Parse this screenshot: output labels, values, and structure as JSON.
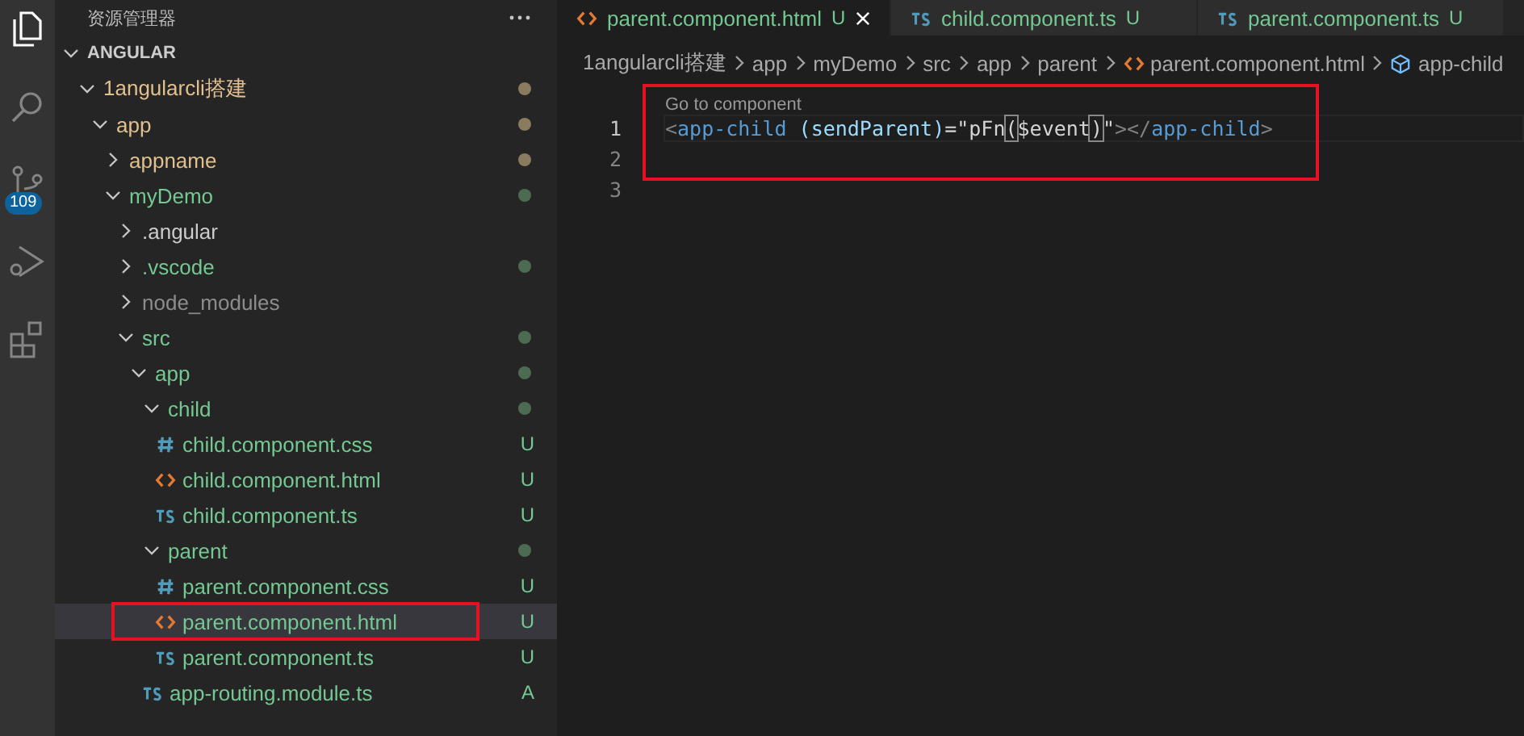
{
  "activity_bar": {
    "scm_badge": "109"
  },
  "explorer": {
    "title": "资源管理器",
    "root": {
      "name": "ANGULAR",
      "expanded": true,
      "children": [
        {
          "name": "1angularcli搭建",
          "kind": "folder",
          "expanded": true,
          "modified": true,
          "ignored": false,
          "color": "#8a7a5e",
          "children": [
            {
              "name": "app",
              "kind": "folder",
              "expanded": true,
              "modified": true,
              "ignored": false,
              "color": "#8a7a5e",
              "children": [
                {
                  "name": "appname",
                  "kind": "folder",
                  "expanded": false,
                  "modified": true,
                  "ignored": false,
                  "color": "#8a7a5e"
                },
                {
                  "name": "myDemo",
                  "kind": "folder",
                  "expanded": true,
                  "modified": false,
                  "ignored": false,
                  "color": "#4d6b52",
                  "children": [
                    {
                      "name": ".angular",
                      "kind": "folder",
                      "expanded": false,
                      "modified": false,
                      "ignored": false
                    },
                    {
                      "name": ".vscode",
                      "kind": "folder",
                      "expanded": false,
                      "modified": false,
                      "ignored": false,
                      "color": "#4d6b52"
                    },
                    {
                      "name": "node_modules",
                      "kind": "folder",
                      "expanded": false,
                      "modified": false,
                      "ignored": true
                    },
                    {
                      "name": "src",
                      "kind": "folder",
                      "expanded": true,
                      "modified": false,
                      "ignored": false,
                      "color": "#4d6b52",
                      "children": [
                        {
                          "name": "app",
                          "kind": "folder",
                          "expanded": true,
                          "modified": false,
                          "ignored": false,
                          "color": "#4d6b52",
                          "children": [
                            {
                              "name": "child",
                              "kind": "folder",
                              "expanded": true,
                              "modified": false,
                              "ignored": false,
                              "color": "#4d6b52",
                              "children": [
                                {
                                  "name": "child.component.css",
                                  "kind": "css",
                                  "modified": false,
                                  "ignored": false,
                                  "badge": "U",
                                  "selected": false
                                },
                                {
                                  "name": "child.component.html",
                                  "kind": "html",
                                  "modified": false,
                                  "ignored": false,
                                  "badge": "U",
                                  "selected": false
                                },
                                {
                                  "name": "child.component.ts",
                                  "kind": "ts",
                                  "modified": false,
                                  "ignored": false,
                                  "badge": "U",
                                  "selected": false
                                }
                              ]
                            },
                            {
                              "name": "parent",
                              "kind": "folder",
                              "expanded": true,
                              "modified": false,
                              "ignored": false,
                              "color": "#4d6b52",
                              "children": [
                                {
                                  "name": "parent.component.css",
                                  "kind": "css",
                                  "modified": false,
                                  "ignored": false,
                                  "badge": "U",
                                  "selected": false
                                },
                                {
                                  "name": "parent.component.html",
                                  "kind": "html",
                                  "modified": false,
                                  "ignored": false,
                                  "badge": "U",
                                  "selected": true,
                                  "annotated": true
                                },
                                {
                                  "name": "parent.component.ts",
                                  "kind": "ts",
                                  "modified": false,
                                  "ignored": false,
                                  "badge": "U",
                                  "selected": false
                                }
                              ]
                            },
                            {
                              "name": "app-routing.module.ts",
                              "kind": "ts",
                              "modified": false,
                              "ignored": false,
                              "badge": "A",
                              "selected": false
                            }
                          ]
                        }
                      ]
                    }
                  ]
                }
              ]
            }
          ]
        }
      ]
    }
  },
  "tabs": [
    {
      "label": "parent.component.html",
      "kind": "html",
      "badge": "U",
      "selected": true
    },
    {
      "label": "child.component.ts",
      "kind": "ts",
      "badge": "U",
      "selected": false
    },
    {
      "label": "parent.component.ts",
      "kind": "ts",
      "badge": "U",
      "selected": false
    }
  ],
  "breadcrumbs": [
    {
      "text": "1angularcli搭建",
      "kind": "folder"
    },
    {
      "text": "app",
      "kind": "folder"
    },
    {
      "text": "myDemo",
      "kind": "folder"
    },
    {
      "text": "src",
      "kind": "folder"
    },
    {
      "text": "app",
      "kind": "folder"
    },
    {
      "text": "parent",
      "kind": "folder"
    },
    {
      "text": "parent.component.html",
      "kind": "html"
    },
    {
      "text": "app-child",
      "kind": "element"
    }
  ],
  "editor": {
    "annotated": true,
    "code_lens": "Go to component",
    "lines": [
      {
        "number": "1",
        "current": true,
        "tokens": [
          {
            "text": "<",
            "kind": "punct"
          },
          {
            "text": "app-child",
            "kind": "tag"
          },
          {
            "text": " (sendParent)",
            "kind": "attr"
          },
          {
            "text": "=\"pFn",
            "kind": "expr"
          },
          {
            "text": "(",
            "kind": "match"
          },
          {
            "text": "$event",
            "kind": "expr"
          },
          {
            "text": ")",
            "kind": "match"
          },
          {
            "text": "\"",
            "kind": "expr"
          },
          {
            "text": "></",
            "kind": "punct"
          },
          {
            "text": "app-child",
            "kind": "tag"
          },
          {
            "text": ">",
            "kind": "punct"
          }
        ]
      },
      {
        "number": "2",
        "current": false
      },
      {
        "number": "3",
        "current": false
      }
    ]
  }
}
